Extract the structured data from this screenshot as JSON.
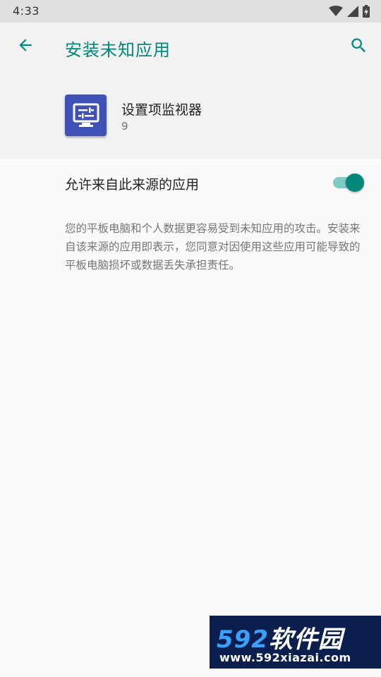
{
  "status_bar": {
    "time": "4:33",
    "icons": [
      "wifi-icon",
      "signal-icon",
      "battery-charging-icon"
    ]
  },
  "app_bar": {
    "title": "安装未知应用",
    "back_icon": "arrow-left-icon",
    "search_icon": "search-icon",
    "accent_color": "#00897b"
  },
  "app_info": {
    "name": "设置项监视器",
    "version": "9",
    "icon": "monitor-settings-icon",
    "icon_color": "#3f51b5"
  },
  "preference": {
    "label": "允许来自此来源的应用",
    "enabled": true
  },
  "summary": "您的平板电脑和个人数据更容易受到未知应用的攻击。安装来自该来源的应用即表示，您同意对因使用这些应用可能导致的平板电脑损坏或数据丢失承担责任。",
  "watermark": {
    "number": "592",
    "brand": "软件园",
    "url": "www.592xiazai.com"
  }
}
